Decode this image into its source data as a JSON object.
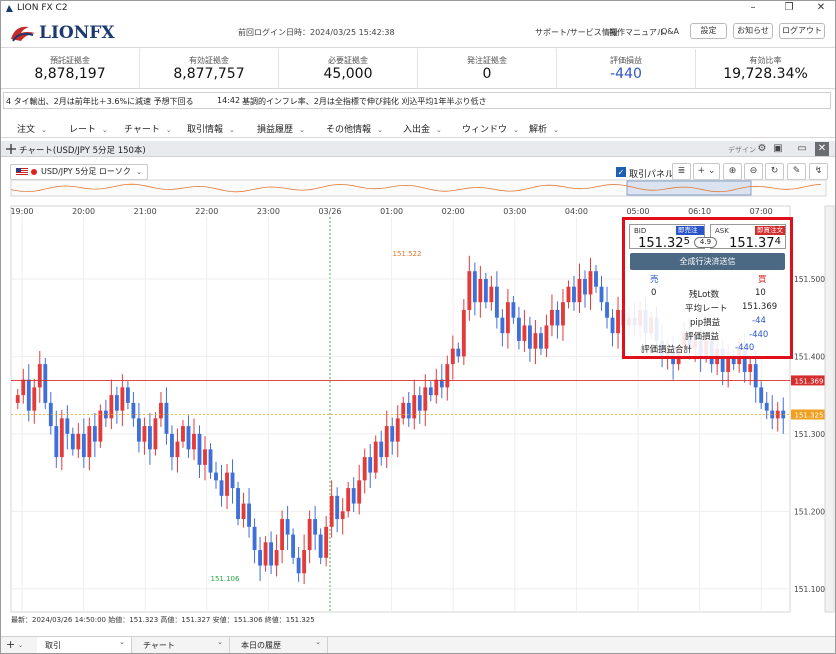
{
  "window": {
    "title": "LION FX C2",
    "minimize": "–",
    "maximize": "❐",
    "close": "✕"
  },
  "header": {
    "logo_text": "LIONFX",
    "last_login": "前回ログイン日時：2024/03/25 15:42:38",
    "links": [
      "サポート/サービス情報",
      "操作マニュアル",
      "Q&A"
    ],
    "buttons": [
      "設定",
      "お知らせ",
      "ログアウト"
    ]
  },
  "summary": [
    {
      "label": "預託証拠金",
      "value": "8,878,197"
    },
    {
      "label": "有効証拠金",
      "value": "8,877,757"
    },
    {
      "label": "必要証拠金",
      "value": "45,000"
    },
    {
      "label": "発注証拠金",
      "value": "0"
    },
    {
      "label": "評価損益",
      "value": "-440",
      "color": "#2f55c8"
    },
    {
      "label": "有効比率",
      "value": "19,728.34%"
    }
  ],
  "ticker": {
    "left": "4  タイ輸出、2月は前年比＋3.6%に減速  予想下回る",
    "time": "14:42",
    "right": "基調的インフレ率、2月は全指標で伸び鈍化  刈込平均1年半ぶり低さ"
  },
  "menu": [
    "注文",
    "レート",
    "チャート",
    "取引情報",
    "損益履歴",
    "その他情報",
    "入出金",
    "ウィンドウ",
    "解析"
  ],
  "panel": {
    "title": "チャート(USD/JPY 5分足 150本)",
    "design": "デザイン"
  },
  "toolbar": {
    "symbol": "USD/JPY 5分足 ローソク BID",
    "trade_panel_label": "取引パネル",
    "trade_panel_checked": true
  },
  "chart_data": {
    "type": "candlestick",
    "x_ticks": [
      "19:00",
      "20:00",
      "21:00",
      "22:00",
      "23:00",
      "03/26",
      "01:00",
      "02:00",
      "03:00",
      "04:00",
      "05:00",
      "06:10",
      "07:00"
    ],
    "y_ticks": [
      "151.500",
      "151.400",
      "151.300",
      "151.200",
      "151.100"
    ],
    "ylim": [
      151.07,
      151.58
    ],
    "high_label": "151.522",
    "low_label": "151.106",
    "price_tags": [
      {
        "value": 151.369,
        "label": "151.369",
        "color": "#d42d2d"
      },
      {
        "value": 151.325,
        "label": "151.325",
        "color": "#f0a020"
      }
    ],
    "up_color": "#e23b3b",
    "down_color": "#3f6fd8",
    "closes": [
      151.35,
      151.37,
      151.33,
      151.36,
      151.39,
      151.34,
      151.31,
      151.27,
      151.32,
      151.3,
      151.28,
      151.3,
      151.27,
      151.31,
      151.29,
      151.33,
      151.32,
      151.35,
      151.33,
      151.36,
      151.34,
      151.32,
      151.29,
      151.31,
      151.28,
      151.32,
      151.34,
      151.3,
      151.27,
      151.29,
      151.31,
      151.28,
      151.3,
      151.26,
      151.28,
      151.25,
      151.24,
      151.22,
      151.25,
      151.23,
      151.19,
      151.21,
      151.18,
      151.15,
      151.13,
      151.16,
      151.13,
      151.15,
      151.19,
      151.17,
      151.14,
      151.12,
      151.15,
      151.19,
      151.17,
      151.14,
      151.18,
      151.22,
      151.19,
      151.2,
      151.23,
      151.21,
      151.24,
      151.27,
      151.25,
      151.29,
      151.27,
      151.31,
      151.29,
      151.32,
      151.34,
      151.32,
      151.35,
      151.33,
      151.36,
      151.35,
      151.37,
      151.36,
      151.39,
      151.41,
      151.4,
      151.46,
      151.51,
      151.47,
      151.5,
      151.47,
      151.49,
      151.45,
      151.43,
      151.47,
      151.45,
      151.42,
      151.44,
      151.41,
      151.43,
      151.41,
      151.44,
      151.46,
      151.44,
      151.47,
      151.49,
      151.47,
      151.5,
      151.48,
      151.51,
      151.49,
      151.47,
      151.45,
      151.43,
      151.46,
      151.44,
      151.45,
      151.44,
      151.46,
      151.43,
      151.45,
      151.42,
      151.4,
      151.41,
      151.39,
      151.41,
      151.43,
      151.41,
      151.42,
      151.4,
      151.42,
      151.39,
      151.41,
      151.38,
      151.4,
      151.39,
      151.41,
      151.38,
      151.39,
      151.36,
      151.34,
      151.33,
      151.32,
      151.33,
      151.32
    ]
  },
  "footer_info": "最新：2024/03/26 14:50:00  始値：151.323  高値：151.327  安値：151.306  終値：151.325",
  "order_panel": {
    "bid_label": "BID",
    "ask_label": "ASK",
    "sell_tag": "即売注文",
    "buy_tag": "即買注文",
    "bid_main": "151.32",
    "bid_pip": "5",
    "ask_main": "151.37",
    "ask_pip": "4",
    "spread": "4.9",
    "settle_all": "全成行決済送信",
    "sell": "売",
    "buy": "買",
    "rows": [
      {
        "sell": "0",
        "label": "残Lot数",
        "buy": "10"
      },
      {
        "sell": "",
        "label": "平均レート",
        "buy": "151.369"
      },
      {
        "sell": "",
        "label": "pip損益",
        "buy": "-44"
      },
      {
        "sell": "",
        "label": "評価損益",
        "buy": "-440"
      }
    ],
    "total_label": "評価損益合計",
    "total_value": "-440"
  },
  "bottom_tabs": [
    "取引",
    "チャート",
    "本日の履歴"
  ]
}
